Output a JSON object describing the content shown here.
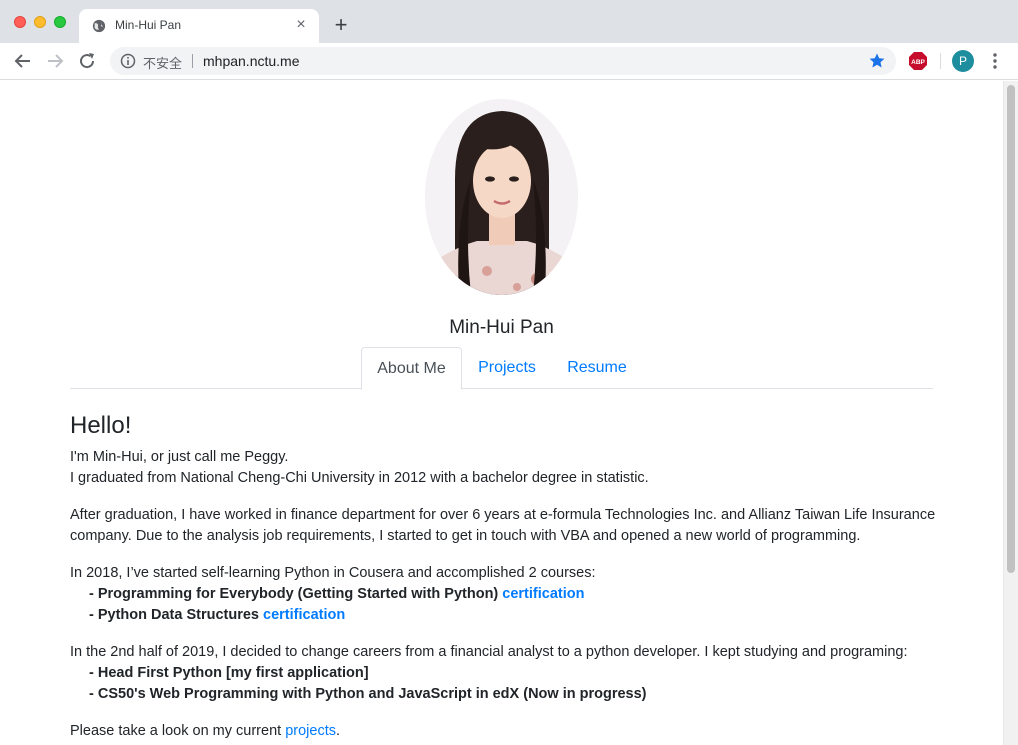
{
  "browser": {
    "tab_title": "Min-Hui Pan",
    "new_tab": "+",
    "close": "×",
    "insecure_label": "不安全",
    "url": "mhpan.nctu.me",
    "avatar_letter": "P",
    "abp_label": "ABP"
  },
  "profile": {
    "name": "Min-Hui Pan"
  },
  "nav": {
    "tabs": [
      {
        "label": "About Me",
        "active": true
      },
      {
        "label": "Projects",
        "active": false
      },
      {
        "label": "Resume",
        "active": false
      }
    ]
  },
  "about": {
    "heading": "Hello!",
    "intro_line1": "I'm Min-Hui, or just call me Peggy.",
    "intro_line2": "I graduated from National Cheng-Chi University in 2012 with a bachelor degree in statistic.",
    "work": "After graduation, I have worked in finance department for over 6 years at e-formula Technologies Inc. and Allianz Taiwan Life Insurance company. Due to the analysis job requirements, I started to get in touch with VBA and opened a new world of programming.",
    "python_intro": "In 2018, I’ve started self-learning Python in Cousera and accomplished 2 courses:",
    "courses": [
      {
        "text": "- Programming for Everybody (Getting Started with Python) ",
        "link": "certification"
      },
      {
        "text": "- Python Data Structures ",
        "link": "certification"
      }
    ],
    "career_intro": "In the 2nd half of 2019, I decided to change careers from a financial analyst to a python developer. I kept studying and programing:",
    "studies": [
      "- Head First Python [my first application]",
      "- CS50's Web Programming with Python and JavaScript in edX (Now in progress)"
    ],
    "outro_prefix": "Please take a look on my current ",
    "outro_link": "projects",
    "outro_suffix": "."
  }
}
